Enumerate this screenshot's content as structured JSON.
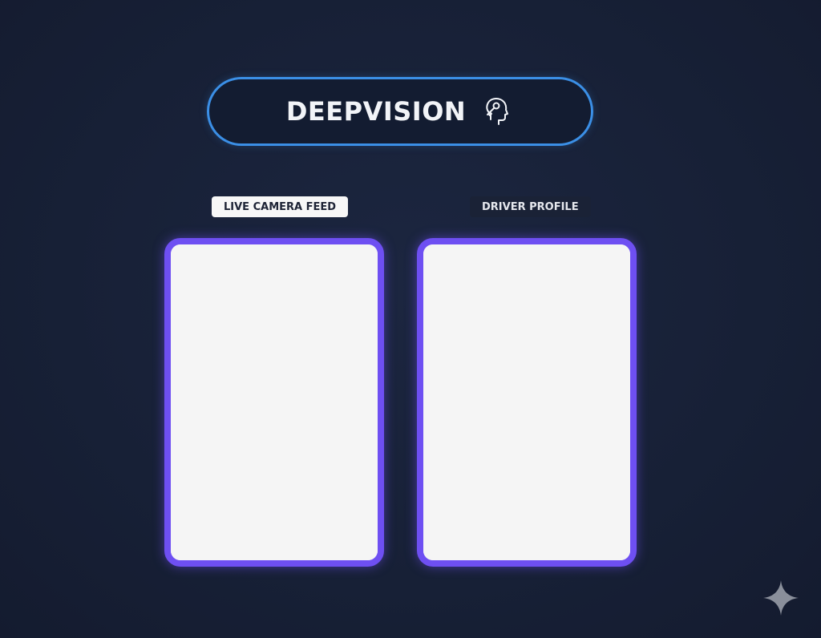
{
  "header": {
    "title": "DEEPVISION",
    "icon": "head-key-icon"
  },
  "panels": [
    {
      "label": "LIVE CAMERA FEED",
      "label_style": "light"
    },
    {
      "label": "DRIVER PROFILE",
      "label_style": "dark"
    }
  ],
  "colors": {
    "background": "#18203a",
    "title_border": "#3b8fe6",
    "panel_border": "#6e4ff2",
    "panel_fill": "#f5f5f5",
    "label_light_bg": "#f7f7f7"
  },
  "watermark": {
    "icon": "sparkle-icon"
  }
}
